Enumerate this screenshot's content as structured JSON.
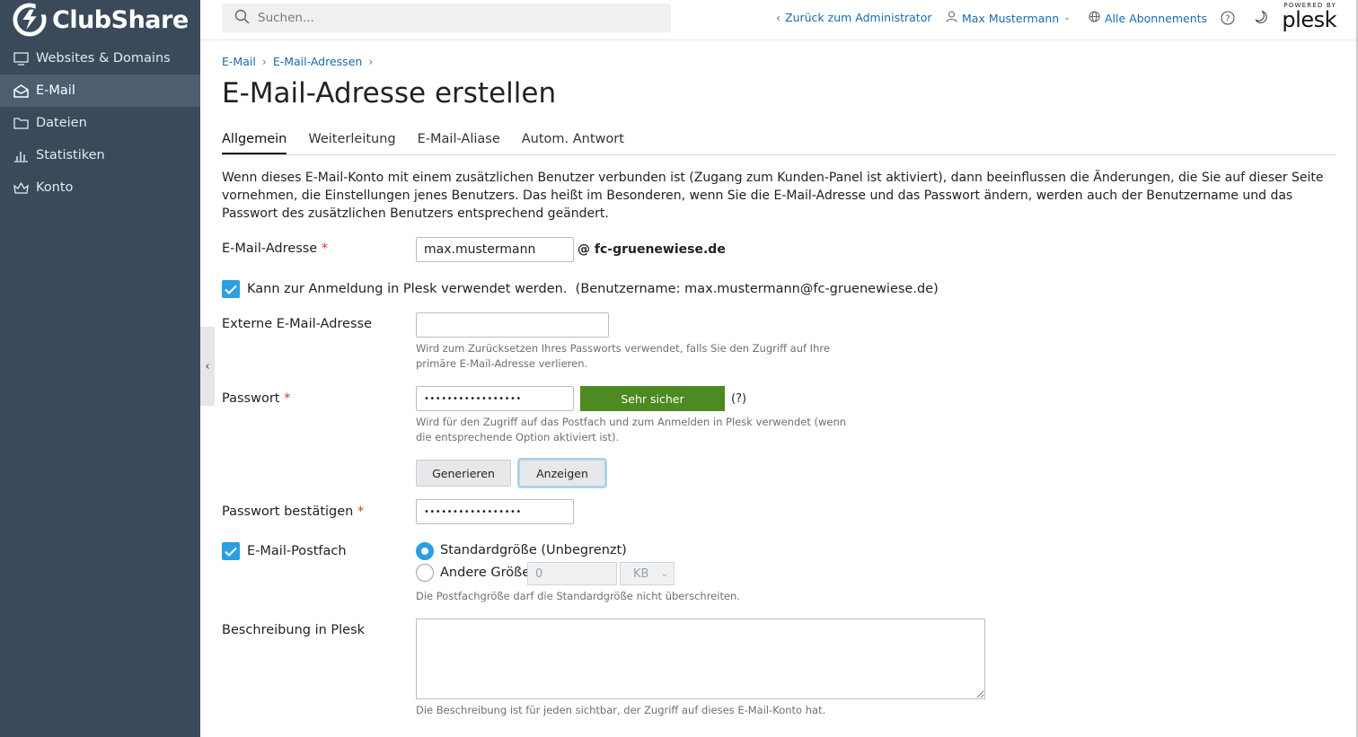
{
  "brand": {
    "name": "ClubShare"
  },
  "sidebar": {
    "items": [
      {
        "label": "Websites & Domains",
        "icon": "monitor-icon"
      },
      {
        "label": "E-Mail",
        "icon": "envelope-icon",
        "active": true
      },
      {
        "label": "Dateien",
        "icon": "folder-icon"
      },
      {
        "label": "Statistiken",
        "icon": "bar-chart-icon"
      },
      {
        "label": "Konto",
        "icon": "account-icon"
      }
    ]
  },
  "header": {
    "search_placeholder": "Suchen...",
    "back_to_admin": "Zurück zum Administrator",
    "user_name": "Max Mustermann",
    "subscriptions": "Alle Abonnements",
    "powered_by": "POWERED BY",
    "plesk": "plesk"
  },
  "breadcrumb": [
    "E-Mail",
    "E-Mail-Adressen"
  ],
  "page_title": "E-Mail-Adresse erstellen",
  "tabs": [
    "Allgemein",
    "Weiterleitung",
    "E-Mail-Aliase",
    "Autom. Antwort"
  ],
  "intro": "Wenn dieses E-Mail-Konto mit einem zusätzlichen Benutzer verbunden ist (Zugang zum Kunden-Panel ist aktiviert), dann beeinflussen die Änderungen, die Sie auf dieser Seite vornehmen, die Einstellungen jenes Benutzers. Das heißt im Besonderen, wenn Sie die E-Mail-Adresse und das Passwort ändern, werden auch der Benutzername und das Passwort des zusätzlichen Benutzers entsprechend geändert.",
  "form": {
    "email_label": "E-Mail-Adresse",
    "email_value": "max.mustermann",
    "email_domain": "@ fc-gruenewiese.de",
    "login_checkbox": "Kann zur Anmeldung in Plesk verwendet werden.",
    "login_username": "(Benutzername: max.mustermann@fc-gruenewiese.de)",
    "external_label": "Externe E-Mail-Adresse",
    "external_value": "",
    "external_help": "Wird zum Zurücksetzen Ihres Passworts verwendet, falls Sie den Zugriff auf Ihre primäre E-Mail-Adresse verlieren.",
    "password_label": "Passwort",
    "password_value": "•••••••••••••••••",
    "strength": "Sehr sicher",
    "strength_help": "(?)",
    "password_help": "Wird für den Zugriff auf das Postfach und zum Anmelden in Plesk verwendet (wenn die entsprechende Option aktiviert ist).",
    "generate_button": "Generieren",
    "show_button": "Anzeigen",
    "confirm_label": "Passwort bestätigen",
    "confirm_value": "•••••••••••••••••",
    "mailbox_label": "E-Mail-Postfach",
    "size_default": "Standardgröße (Unbegrenzt)",
    "size_other": "Andere Größe",
    "size_value": "0",
    "size_unit": "KB",
    "mailbox_help": "Die Postfachgröße darf die Standardgröße nicht überschreiten.",
    "description_label": "Beschreibung in Plesk",
    "description_help": "Die Beschreibung ist für jeden sichtbar, der Zugriff auf dieses E-Mail-Konto hat.",
    "required_mark": "*"
  },
  "colors": {
    "sidebar_bg": "#3a4a5a",
    "link": "#1a6aab",
    "checkbox": "#2aa0e2",
    "strength": "#4d8a21",
    "required": "#d0392b"
  }
}
